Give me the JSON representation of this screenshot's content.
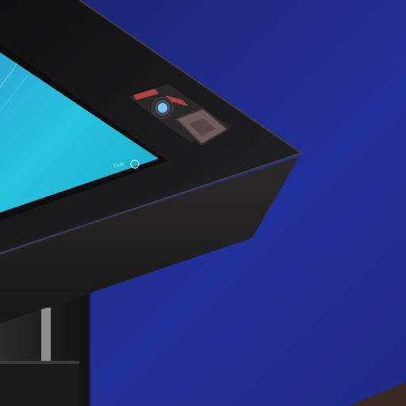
{
  "scene": {
    "subject": "kiosk-screen-corner",
    "background_color": "#1f2a78",
    "bezel_color": "#1b1b1c",
    "screen_color": "#22b5d6",
    "screen_label": "Cold"
  },
  "controls": [
    {
      "name": "red-indicator",
      "color": "#b5433d"
    },
    {
      "name": "blue-power-light",
      "color": "#7cc4ff"
    },
    {
      "name": "diamond-button",
      "color": "#6f5a5a"
    }
  ]
}
